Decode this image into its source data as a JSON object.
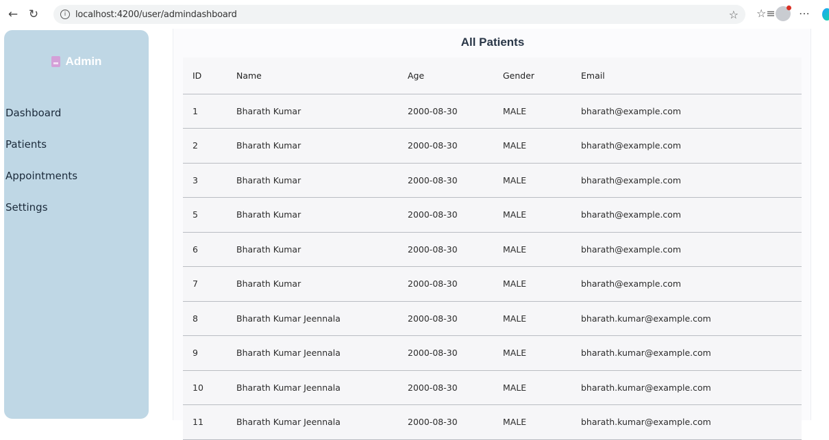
{
  "browser": {
    "url": "localhost:4200/user/admindashboard",
    "icons": [
      "back-arrow-icon",
      "reload-icon",
      "info-icon",
      "star-icon",
      "favorites-icon",
      "profile-icon",
      "more-icon",
      "edge-icon"
    ]
  },
  "sidebar": {
    "brand": "Admin",
    "items": [
      {
        "label": "Dashboard"
      },
      {
        "label": "Patients"
      },
      {
        "label": "Appointments"
      },
      {
        "label": "Settings"
      }
    ]
  },
  "main": {
    "title": "All Patients",
    "columns": [
      "ID",
      "Name",
      "Age",
      "Gender",
      "Email"
    ],
    "rows": [
      {
        "id": "1",
        "name": "Bharath Kumar",
        "age": "2000-08-30",
        "gender": "MALE",
        "email": "bharath@example.com"
      },
      {
        "id": "2",
        "name": "Bharath Kumar",
        "age": "2000-08-30",
        "gender": "MALE",
        "email": "bharath@example.com"
      },
      {
        "id": "3",
        "name": "Bharath Kumar",
        "age": "2000-08-30",
        "gender": "MALE",
        "email": "bharath@example.com"
      },
      {
        "id": "5",
        "name": "Bharath Kumar",
        "age": "2000-08-30",
        "gender": "MALE",
        "email": "bharath@example.com"
      },
      {
        "id": "6",
        "name": "Bharath Kumar",
        "age": "2000-08-30",
        "gender": "MALE",
        "email": "bharath@example.com"
      },
      {
        "id": "7",
        "name": "Bharath Kumar",
        "age": "2000-08-30",
        "gender": "MALE",
        "email": "bharath@example.com"
      },
      {
        "id": "8",
        "name": "Bharath Kumar Jeennala",
        "age": "2000-08-30",
        "gender": "MALE",
        "email": "bharath.kumar@example.com"
      },
      {
        "id": "9",
        "name": "Bharath Kumar Jeennala",
        "age": "2000-08-30",
        "gender": "MALE",
        "email": "bharath.kumar@example.com"
      },
      {
        "id": "10",
        "name": "Bharath Kumar Jeennala",
        "age": "2000-08-30",
        "gender": "MALE",
        "email": "bharath.kumar@example.com"
      },
      {
        "id": "11",
        "name": "Bharath Kumar Jeennala",
        "age": "2000-08-30",
        "gender": "MALE",
        "email": "bharath.kumar@example.com"
      }
    ]
  },
  "colors": {
    "sidebar_bg": "#bfd7e5",
    "brand_text": "#ffffff",
    "title_text": "#2a3748",
    "row_bg": "#f6f6f8",
    "row_border": "#b9bcc2"
  }
}
